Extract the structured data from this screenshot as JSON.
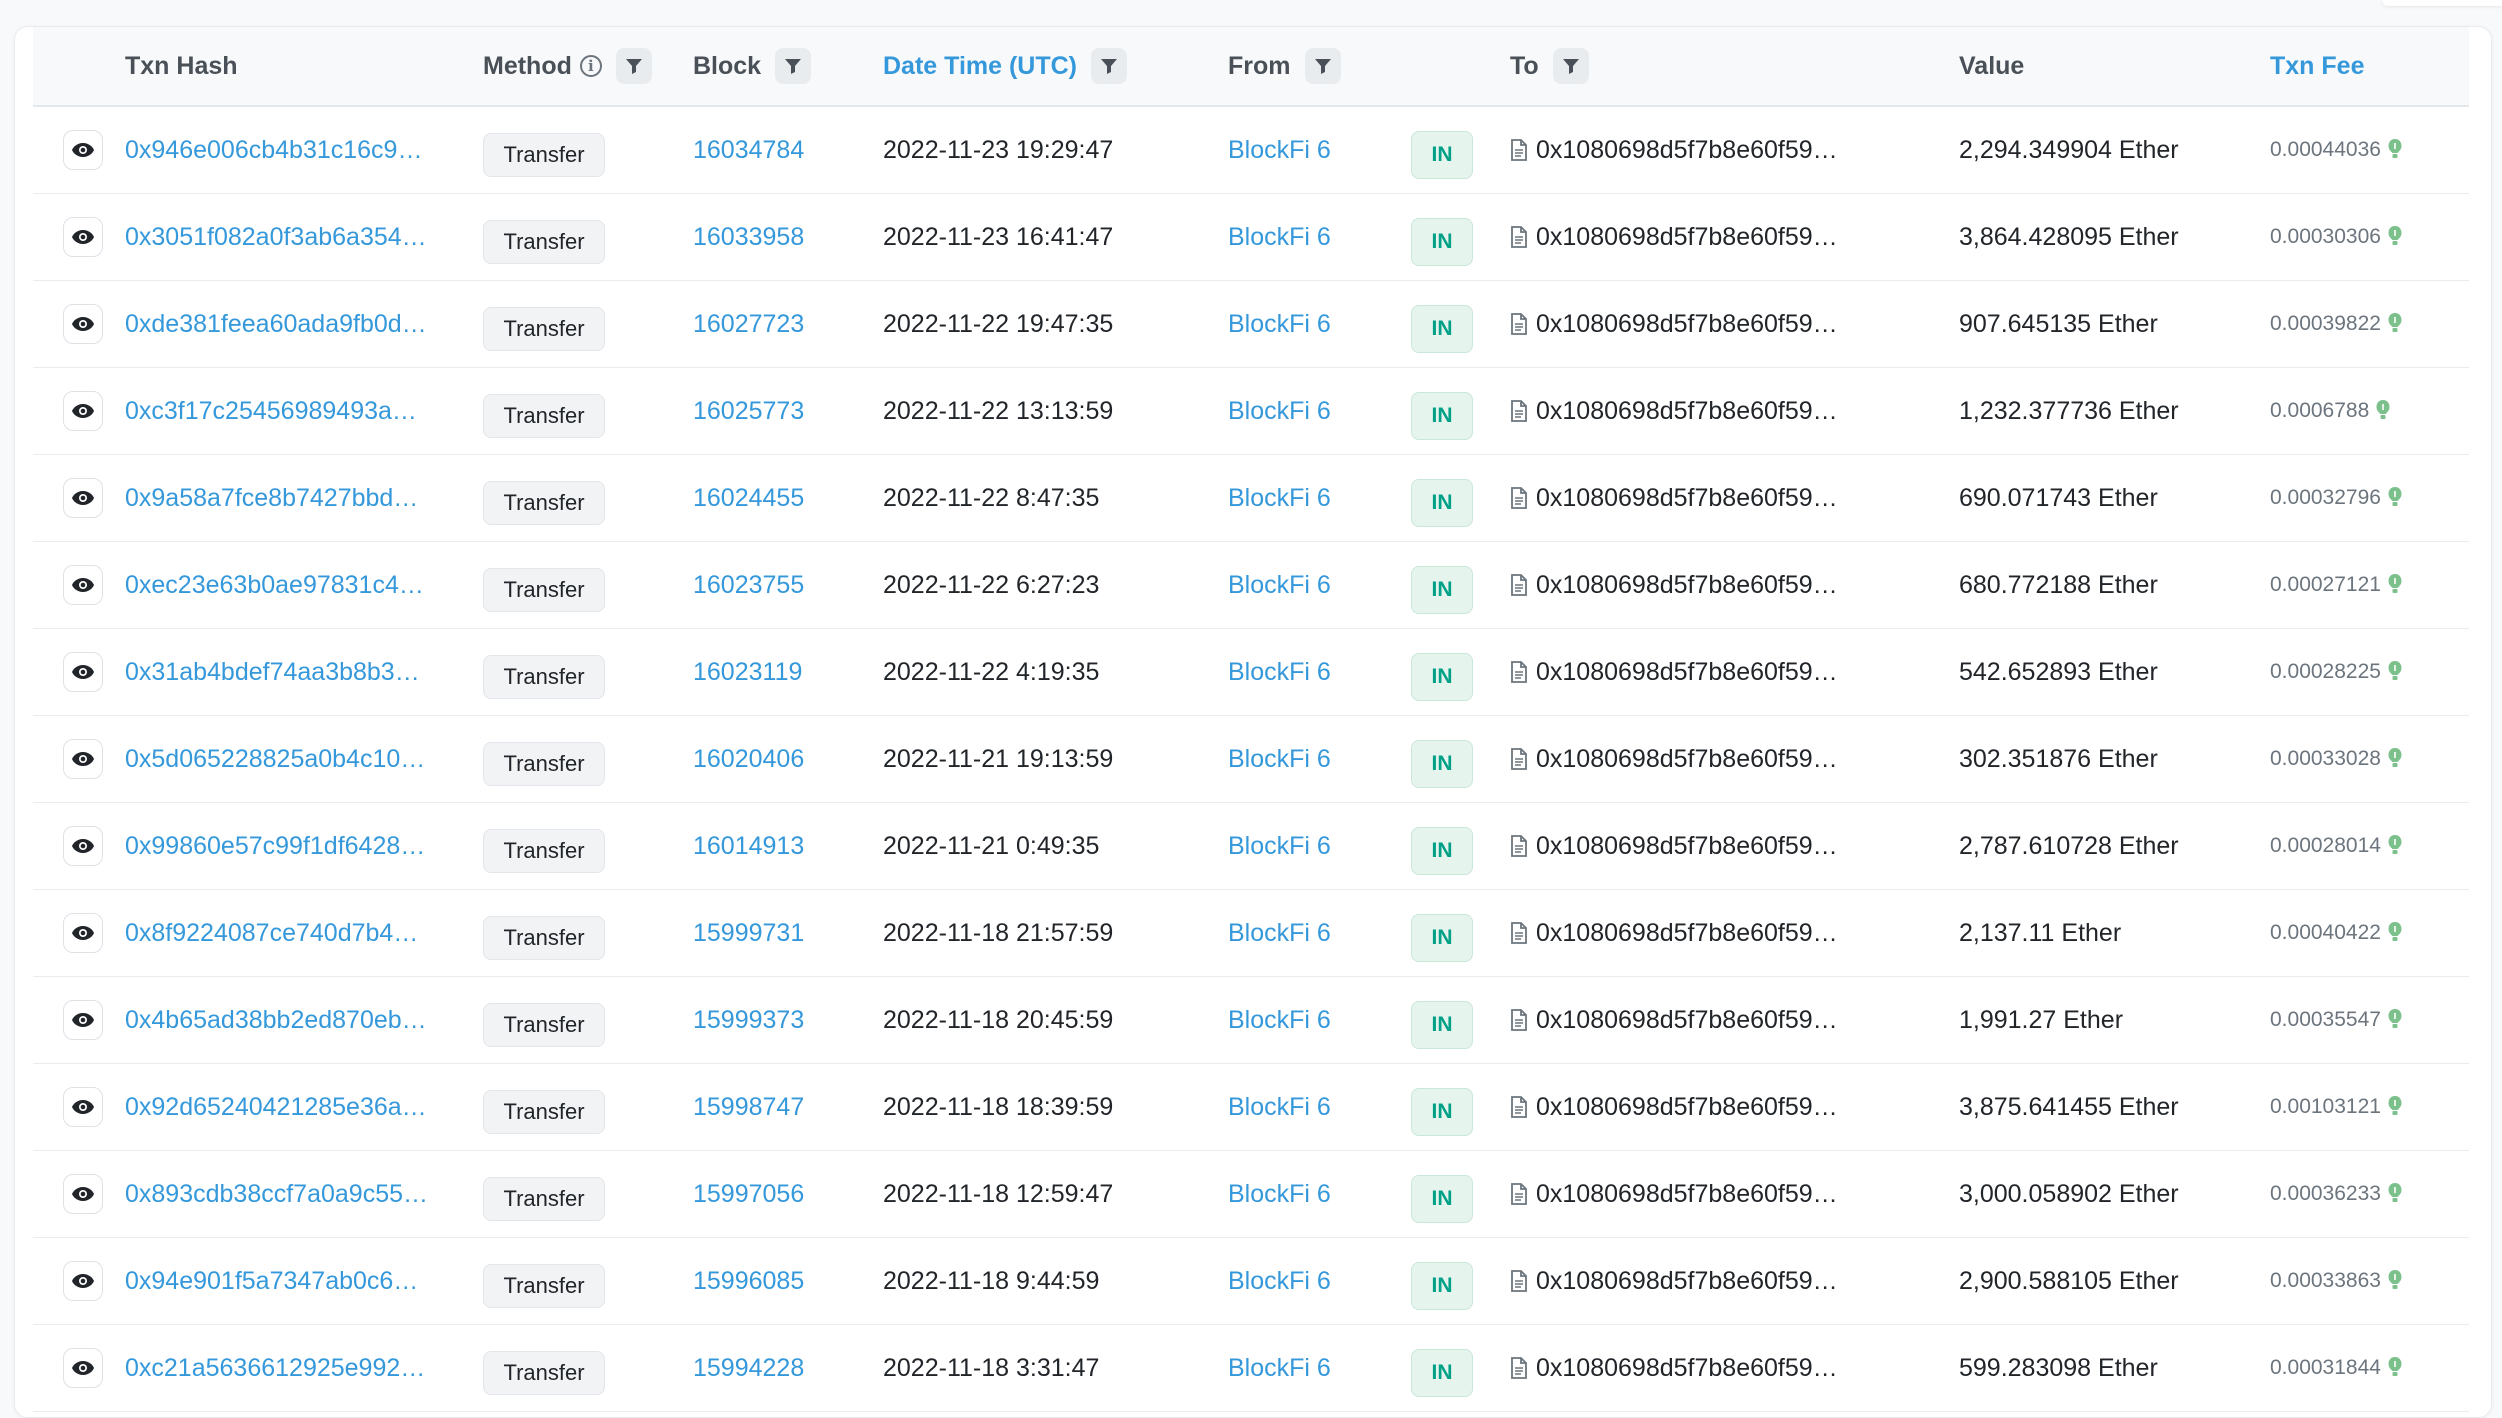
{
  "headers": {
    "txn_hash": "Txn Hash",
    "method": "Method",
    "block": "Block",
    "datetime": "Date Time (UTC)",
    "from": "From",
    "to": "To",
    "value": "Value",
    "txn_fee": "Txn Fee"
  },
  "icons": {
    "filter": "filter-icon",
    "info": "info-icon",
    "view": "eye-icon",
    "contract": "file-icon",
    "fee": "gas-icon"
  },
  "colors": {
    "link": "#3498db",
    "in_badge_bg": "#e6f4ee",
    "in_badge_text": "#00a186",
    "fee_icon": "#7cc08c"
  },
  "rows": [
    {
      "hash": "0x946e006cb4b31c16c9…",
      "method": "Transfer",
      "block": "16034784",
      "datetime": "2022-11-23 19:29:47",
      "from": "BlockFi 6",
      "direction": "IN",
      "to": "0x1080698d5f7b8e60f59…",
      "value": "2,294.349904 Ether",
      "fee": "0.00044036"
    },
    {
      "hash": "0x3051f082a0f3ab6a354…",
      "method": "Transfer",
      "block": "16033958",
      "datetime": "2022-11-23 16:41:47",
      "from": "BlockFi 6",
      "direction": "IN",
      "to": "0x1080698d5f7b8e60f59…",
      "value": "3,864.428095 Ether",
      "fee": "0.00030306"
    },
    {
      "hash": "0xde381feea60ada9fb0d…",
      "method": "Transfer",
      "block": "16027723",
      "datetime": "2022-11-22 19:47:35",
      "from": "BlockFi 6",
      "direction": "IN",
      "to": "0x1080698d5f7b8e60f59…",
      "value": "907.645135 Ether",
      "fee": "0.00039822"
    },
    {
      "hash": "0xc3f17c25456989493a…",
      "method": "Transfer",
      "block": "16025773",
      "datetime": "2022-11-22 13:13:59",
      "from": "BlockFi 6",
      "direction": "IN",
      "to": "0x1080698d5f7b8e60f59…",
      "value": "1,232.377736 Ether",
      "fee": "0.0006788"
    },
    {
      "hash": "0x9a58a7fce8b7427bbd…",
      "method": "Transfer",
      "block": "16024455",
      "datetime": "2022-11-22 8:47:35",
      "from": "BlockFi 6",
      "direction": "IN",
      "to": "0x1080698d5f7b8e60f59…",
      "value": "690.071743 Ether",
      "fee": "0.00032796"
    },
    {
      "hash": "0xec23e63b0ae97831c4…",
      "method": "Transfer",
      "block": "16023755",
      "datetime": "2022-11-22 6:27:23",
      "from": "BlockFi 6",
      "direction": "IN",
      "to": "0x1080698d5f7b8e60f59…",
      "value": "680.772188 Ether",
      "fee": "0.00027121"
    },
    {
      "hash": "0x31ab4bdef74aa3b8b3…",
      "method": "Transfer",
      "block": "16023119",
      "datetime": "2022-11-22 4:19:35",
      "from": "BlockFi 6",
      "direction": "IN",
      "to": "0x1080698d5f7b8e60f59…",
      "value": "542.652893 Ether",
      "fee": "0.00028225"
    },
    {
      "hash": "0x5d065228825a0b4c10…",
      "method": "Transfer",
      "block": "16020406",
      "datetime": "2022-11-21 19:13:59",
      "from": "BlockFi 6",
      "direction": "IN",
      "to": "0x1080698d5f7b8e60f59…",
      "value": "302.351876 Ether",
      "fee": "0.00033028"
    },
    {
      "hash": "0x99860e57c99f1df6428…",
      "method": "Transfer",
      "block": "16014913",
      "datetime": "2022-11-21 0:49:35",
      "from": "BlockFi 6",
      "direction": "IN",
      "to": "0x1080698d5f7b8e60f59…",
      "value": "2,787.610728 Ether",
      "fee": "0.00028014"
    },
    {
      "hash": "0x8f9224087ce740d7b4…",
      "method": "Transfer",
      "block": "15999731",
      "datetime": "2022-11-18 21:57:59",
      "from": "BlockFi 6",
      "direction": "IN",
      "to": "0x1080698d5f7b8e60f59…",
      "value": "2,137.11 Ether",
      "fee": "0.00040422"
    },
    {
      "hash": "0x4b65ad38bb2ed870eb…",
      "method": "Transfer",
      "block": "15999373",
      "datetime": "2022-11-18 20:45:59",
      "from": "BlockFi 6",
      "direction": "IN",
      "to": "0x1080698d5f7b8e60f59…",
      "value": "1,991.27 Ether",
      "fee": "0.00035547"
    },
    {
      "hash": "0x92d65240421285e36a…",
      "method": "Transfer",
      "block": "15998747",
      "datetime": "2022-11-18 18:39:59",
      "from": "BlockFi 6",
      "direction": "IN",
      "to": "0x1080698d5f7b8e60f59…",
      "value": "3,875.641455 Ether",
      "fee": "0.00103121"
    },
    {
      "hash": "0x893cdb38ccf7a0a9c55…",
      "method": "Transfer",
      "block": "15997056",
      "datetime": "2022-11-18 12:59:47",
      "from": "BlockFi 6",
      "direction": "IN",
      "to": "0x1080698d5f7b8e60f59…",
      "value": "3,000.058902 Ether",
      "fee": "0.00036233"
    },
    {
      "hash": "0x94e901f5a7347ab0c6…",
      "method": "Transfer",
      "block": "15996085",
      "datetime": "2022-11-18 9:44:59",
      "from": "BlockFi 6",
      "direction": "IN",
      "to": "0x1080698d5f7b8e60f59…",
      "value": "2,900.588105 Ether",
      "fee": "0.00033863"
    },
    {
      "hash": "0xc21a5636612925e992…",
      "method": "Transfer",
      "block": "15994228",
      "datetime": "2022-11-18 3:31:47",
      "from": "BlockFi 6",
      "direction": "IN",
      "to": "0x1080698d5f7b8e60f59…",
      "value": "599.283098 Ether",
      "fee": "0.00031844"
    }
  ]
}
